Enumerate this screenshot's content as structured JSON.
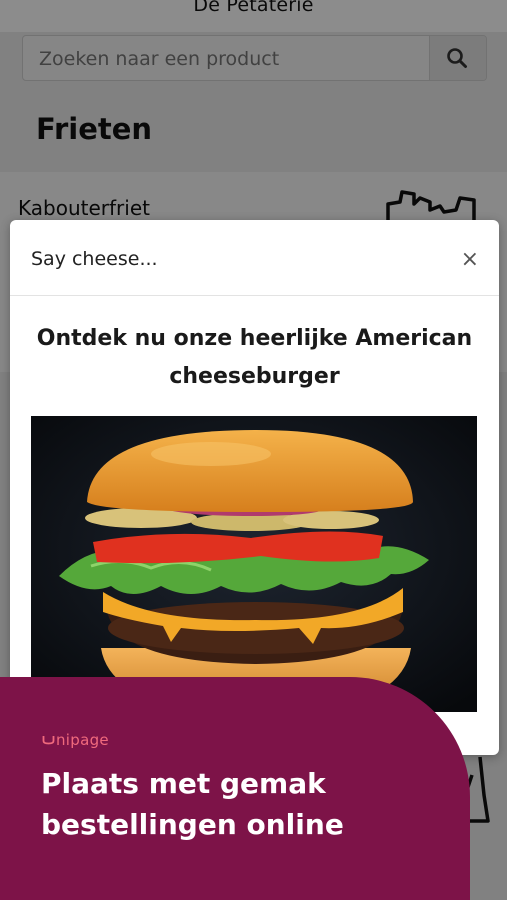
{
  "topbar": {
    "title": "De Petaterie"
  },
  "search": {
    "placeholder": "Zoeken naar een product",
    "button_icon": "search-icon"
  },
  "section": {
    "title": "Frieten"
  },
  "product": {
    "name": "Kabouterfriet",
    "icon": "fries-icon"
  },
  "modal": {
    "title": "Say cheese...",
    "close_label": "×",
    "heading": "Ontdek nu onze heerlijke American cheeseburger",
    "image_subject": "cheeseburger"
  },
  "banner": {
    "logo_text": "nipage",
    "headline": "Plaats met gemak bestellingen online",
    "colors": {
      "background": "#7d1348",
      "logo": "#f06a7d",
      "text": "#ffffff"
    }
  }
}
